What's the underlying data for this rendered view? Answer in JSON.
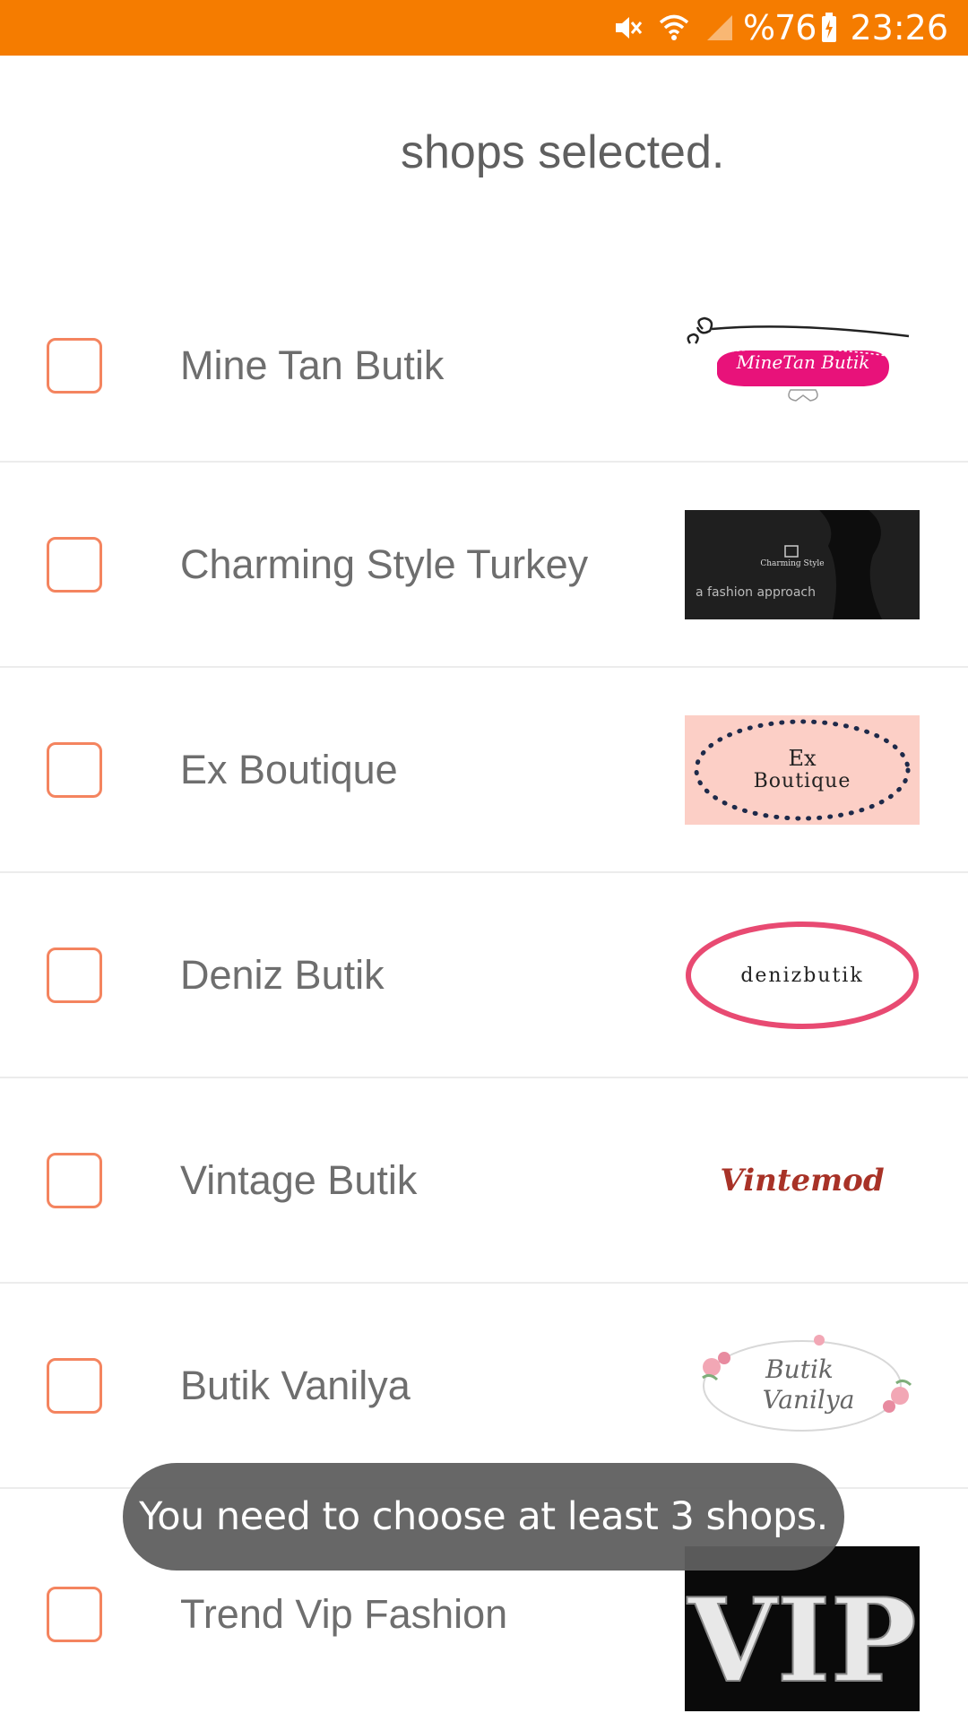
{
  "status_bar": {
    "battery": "%76",
    "time": "23:26",
    "icons": [
      "mute-icon",
      "wifi-icon",
      "signal-icon",
      "battery-charging-icon"
    ]
  },
  "header": {
    "title": "shops selected."
  },
  "shops": [
    {
      "name": "Mine Tan Butik",
      "logo_text": "MineTan Butik",
      "checked": false
    },
    {
      "name": "Charming Style Turkey",
      "logo_text": "Charming Style",
      "logo_sub": "a fashion approach",
      "checked": false
    },
    {
      "name": "Ex Boutique",
      "logo_text": "Ex",
      "logo_text2": "Boutique",
      "checked": false
    },
    {
      "name": "Deniz Butik",
      "logo_text": "denizbutik",
      "checked": false
    },
    {
      "name": "Vintage Butik",
      "logo_text": "Vintemod",
      "checked": false
    },
    {
      "name": "Butik Vanilya",
      "logo_text": "Butik",
      "logo_text2": "Vanilya",
      "checked": false
    },
    {
      "name": "Trend Vip Fashion",
      "logo_text": "VIP",
      "checked": false
    }
  ],
  "toast": {
    "message": "You need to choose at least 3 shops."
  },
  "colors": {
    "status_bar": "#f57c00",
    "checkbox_border": "#f4845f",
    "toast_bg": "#5f5f5f"
  }
}
